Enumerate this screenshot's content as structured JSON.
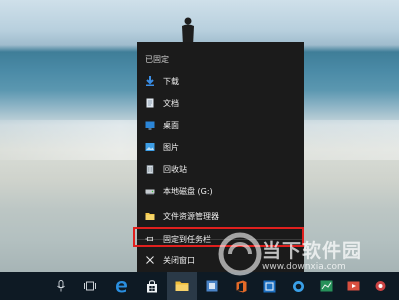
{
  "context_menu": {
    "header": "已固定",
    "items": [
      {
        "label": "下载",
        "icon": "download-arrow-icon"
      },
      {
        "label": "文档",
        "icon": "document-icon"
      },
      {
        "label": "桌面",
        "icon": "desktop-icon"
      },
      {
        "label": "图片",
        "icon": "pictures-icon"
      },
      {
        "label": "回收站",
        "icon": "recycle-bin-icon"
      },
      {
        "label": "本地磁盘 (G:)",
        "icon": "drive-icon"
      }
    ],
    "actions": [
      {
        "label": "文件资源管理器",
        "icon": "folder-icon"
      },
      {
        "label": "固定到任务栏",
        "icon": "pin-icon"
      },
      {
        "label": "关闭窗口",
        "icon": "close-icon"
      }
    ]
  },
  "taskbar": {
    "items": [
      "microphone-icon",
      "task-view-icon",
      "edge-icon",
      "store-icon",
      "file-explorer-icon",
      "office-icon",
      "settings-icon",
      "cortana-icon",
      "chart-app-icon",
      "movie-icon",
      "app-icon"
    ]
  },
  "watermark": {
    "text": "当下软件园",
    "url": "www.downxia.com"
  },
  "colors": {
    "menu_bg": "#1b1b1b",
    "highlight": "#e0201e",
    "taskbar_bg": "#0e1a24"
  }
}
